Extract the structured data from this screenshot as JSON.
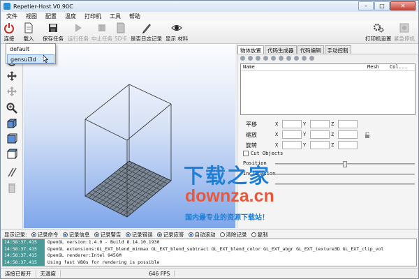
{
  "window": {
    "title": "Repetier-Host V0.90C",
    "minimize": "–",
    "maximize": "□",
    "close": "✕"
  },
  "menu": [
    "文件",
    "视图",
    "配置",
    "温度",
    "打印机",
    "工具",
    "帮助"
  ],
  "toolbar": {
    "connect": "连接",
    "load": "载入",
    "save_job": "保存任务",
    "run_job": "运行任务",
    "stop_job": "中止任务",
    "sd_card": "SD卡",
    "log_toggle": "是否日志记录",
    "show_material": "显示 材料",
    "printer_settings": "打印机设置",
    "emergency_stop": "紧急停机"
  },
  "dropdown": {
    "items": [
      "default",
      "gensui3d"
    ],
    "highlighted": 1
  },
  "right_panel": {
    "tabs": [
      "物体放置",
      "代码生成器",
      "代码编辑",
      "手动控制"
    ],
    "active_tab": 0,
    "object_table_headers": [
      "Name",
      "Mesh",
      "Col..."
    ],
    "transform_rows": [
      {
        "label": "平移",
        "axes": [
          "X",
          "Y",
          "Z"
        ]
      },
      {
        "label": "缩放",
        "axes": [
          "X",
          "Y",
          "Z"
        ]
      },
      {
        "label": "旋转",
        "axes": [
          "X",
          "Y",
          "Z"
        ]
      }
    ],
    "cut_objects": "Cut Objects",
    "position_label": "Position",
    "inclination_label": "Inclination",
    "position_level": 0.5,
    "inclination_level": 0.0
  },
  "watermark": {
    "line1": "下载之家",
    "line2": "downza.cn",
    "line3": "国内最专业的资源下载站！"
  },
  "log_bar": {
    "label": "显示记录:",
    "options": [
      "记录命令",
      "记录信息",
      "记录警告",
      "记录错误",
      "记录应答",
      "自动滚动",
      "清除记录",
      "复制"
    ]
  },
  "log_lines": [
    {
      "time": "14:58:37.415",
      "msg": "OpenGL version:1.4.0 - Build 8.14.10.1930"
    },
    {
      "time": "14:58:37.415",
      "msg": "OpenGL extensions:GL_EXT_blend_minmax GL_EXT_blend_subtract GL_EXT_blend_color GL_EXT_abgr GL_EXT_texture3D GL_EXT_clip_vol"
    },
    {
      "time": "14:58:37.415",
      "msg": "OpenGL renderer:Intel 945GM"
    },
    {
      "time": "14:58:37.415",
      "msg": "Using fast VBOs for rendering is possible"
    }
  ],
  "status": {
    "connection": "连接已断开",
    "temperature": "无温度",
    "fps": "646 FPS"
  },
  "colors": {
    "accent": "#1f7fd6",
    "watermark_orange": "#e8583a",
    "log_time_bg": "#4a9a98",
    "grid": "#5c6670"
  }
}
